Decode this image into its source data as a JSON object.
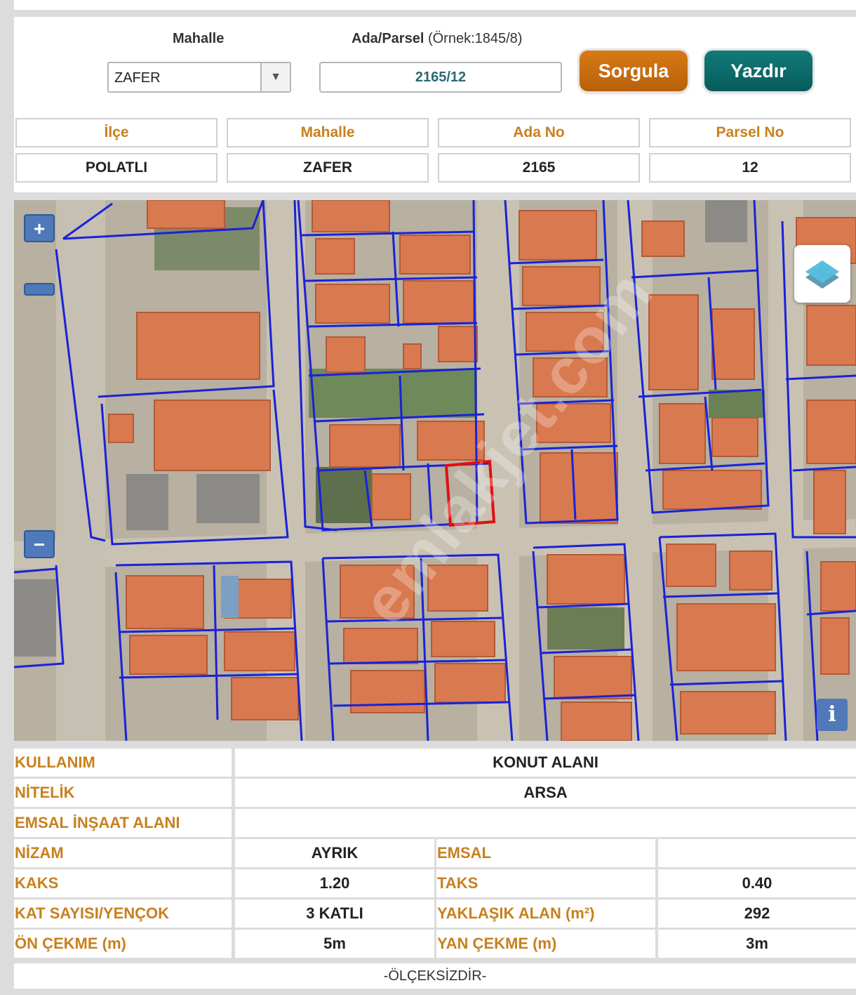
{
  "query": {
    "mahalle_label": "Mahalle",
    "parcel_label": "Ada/Parsel",
    "parcel_hint": "(Örnek:1845/8)",
    "mahalle_value": "ZAFER",
    "parcel_value": "2165/12",
    "sorgula_label": "Sorgula",
    "yazdir_label": "Yazdır"
  },
  "summary": {
    "headers": [
      "İlçe",
      "Mahalle",
      "Ada No",
      "Parsel No"
    ],
    "values": [
      "POLATLI",
      "ZAFER",
      "2165",
      "12"
    ]
  },
  "map": {
    "zoom_in": "+",
    "zoom_out": "−",
    "info": "i",
    "watermark": "emlakjet.com"
  },
  "attributes": {
    "kullanim_k": "KULLANIM",
    "kullanim_v": "KONUT ALANI",
    "nitelik_k": "NİTELİK",
    "nitelik_v": "ARSA",
    "emsal_insaat_k": "EMSAL İNŞAAT ALANI",
    "emsal_insaat_v": "",
    "nizam_k": "NİZAM",
    "nizam_v": "AYRIK",
    "emsal_k": "EMSAL",
    "emsal_v": "",
    "kaks_k": "KAKS",
    "kaks_v": "1.20",
    "taks_k": "TAKS",
    "taks_v": "0.40",
    "kat_k": "KAT SAYISI/YENÇOK",
    "kat_v": "3 KATLI",
    "alan_k": "YAKLAŞIK ALAN (m²)",
    "alan_v": "292",
    "on_k": "ÖN ÇEKME (m)",
    "on_v": "5m",
    "yan_k": "YAN ÇEKME (m)",
    "yan_v": "3m"
  },
  "footer": "-ÖLÇEKSİZDİR-",
  "colors": {
    "header_text": "#c8801e",
    "sorgula": "#c86e10",
    "yazdir": "#0b6b69",
    "parcel_outline": "#1a22d8",
    "selected_parcel": "#e01010"
  }
}
